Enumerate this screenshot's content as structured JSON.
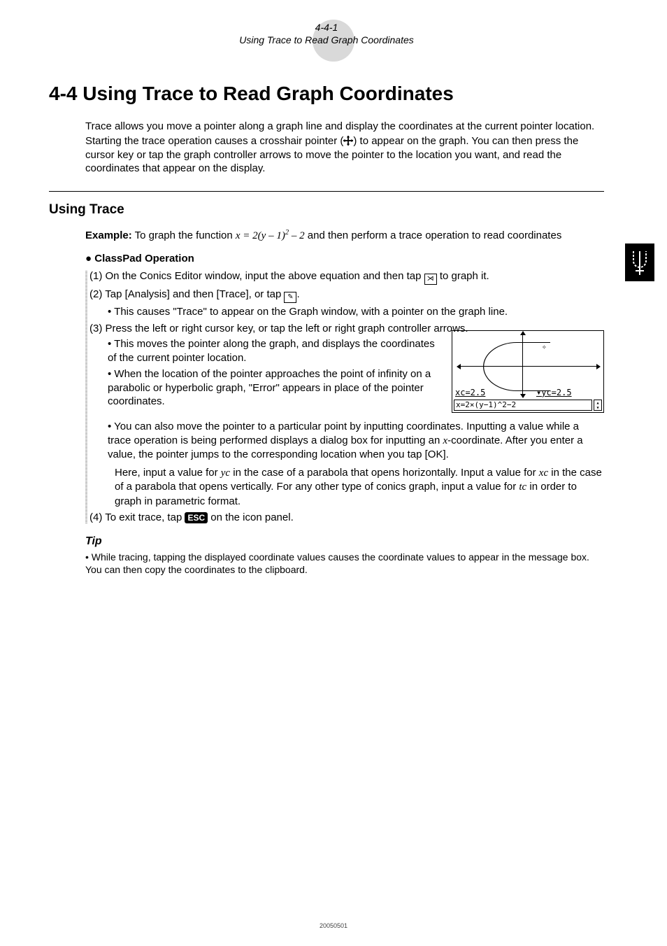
{
  "header": {
    "pagecode": "4-4-1",
    "subtitle": "Using Trace to Read Graph Coordinates"
  },
  "title": "4-4  Using Trace to Read Graph Coordinates",
  "intro": {
    "p1": "Trace allows you move a pointer along a graph line and display the coordinates at the current pointer location.",
    "p2a": "Starting the trace operation causes a crosshair pointer (",
    "p2b": ") to appear on the graph. You can then press the cursor key or tap the graph controller arrows to move the pointer to the location you want, and read the coordinates that appear on the display."
  },
  "section_head": "Using Trace",
  "example": {
    "label": "Example:",
    "text_a": "To graph the function ",
    "text_b": " and then perform a trace operation to read coordinates"
  },
  "op_head": "ClassPad Operation",
  "steps": {
    "s1a": "(1) On the Conics Editor window, input the above equation and then tap ",
    "s1b": " to graph it.",
    "s2a": "(2) Tap [Analysis] and then [Trace], or tap ",
    "s2b": ".",
    "s2sub": "This causes \"Trace\" to appear on the Graph window, with a pointer on the graph line.",
    "s3": "(3) Press the left or right cursor key, or tap the left or right graph controller arrows.",
    "s3sub1": "This moves the pointer along the graph, and displays the coordinates of the current pointer location.",
    "s3sub2": "When the location of the pointer approaches the point of infinity on a parabolic or hyperbolic graph, \"Error\" appears in place of the pointer coordinates.",
    "s3sub3a": "You can also move the pointer to a particular point by inputting coordinates. Inputting a value while a trace operation is being performed displays a dialog box for inputting an ",
    "s3sub3b": "-coordinate. After you enter a value, the pointer jumps to the corresponding location when you tap [OK].",
    "s3para_a": "Here, input a value for ",
    "s3para_b": " in the case of a parabola that opens horizontally. Input a value for ",
    "s3para_c": " in the case of a parabola that opens vertically. For any other type of conics graph, input a value for ",
    "s3para_d": " in order to graph in parametric format.",
    "s4a": "(4) To exit trace, tap ",
    "s4b": " on the icon panel."
  },
  "esc_label": "ESC",
  "screenshot": {
    "xc": "xc=2.5",
    "yc": "yc=2.5",
    "formula": "x=2×(y−1)^2−2"
  },
  "tip": {
    "head": "Tip",
    "body": "While tracing, tapping the displayed coordinate values causes the coordinate values to appear in the message box. You can then copy the coordinates to the clipboard."
  },
  "footer": "20050501",
  "math": {
    "eq_lhs": "x",
    "eq_mid": " = 2(",
    "eq_y": "y",
    "eq_rhs": " – 1)",
    "eq_exp": "2",
    "eq_tail": " – 2",
    "xvar": "x",
    "yc": "yc",
    "xc": "xc",
    "tc": "tc"
  },
  "icons": {
    "graph_icon": "⋊",
    "trace_icon": "✎"
  }
}
